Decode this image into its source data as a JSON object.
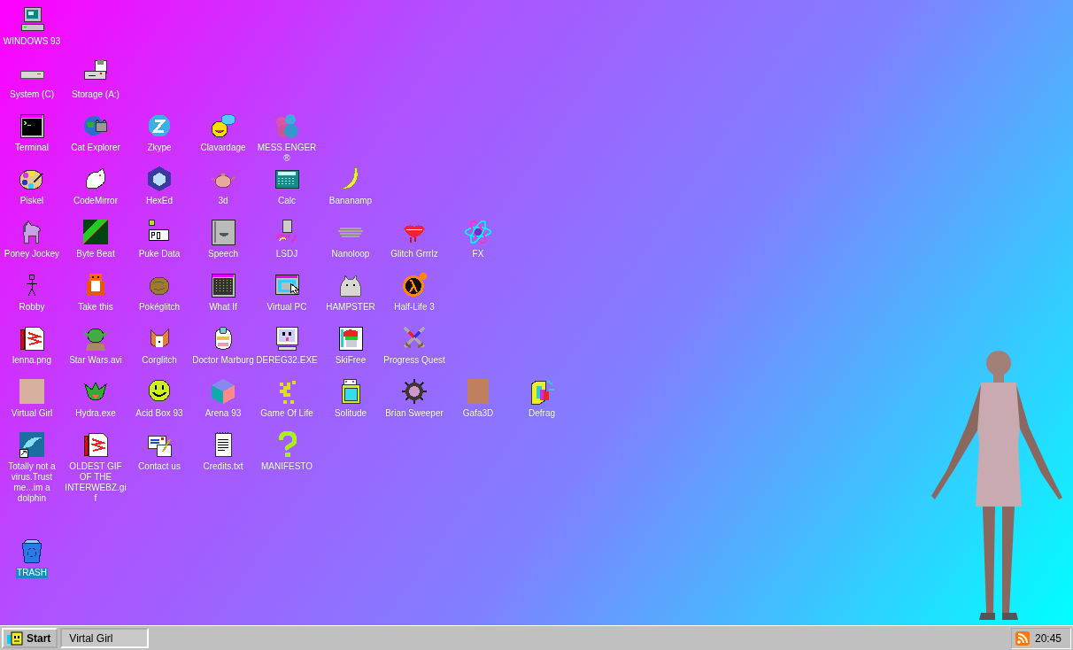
{
  "desktop": {
    "icon_rows": [
      [
        {
          "label": "WINDOWS 93",
          "selected": false
        }
      ],
      [
        {
          "label": "System (C)",
          "selected": false
        },
        {
          "label": "Storage (A:)",
          "selected": false
        }
      ],
      [
        {
          "label": "Terminal",
          "selected": false
        },
        {
          "label": "Cat Explorer",
          "selected": false
        },
        {
          "label": "Zkype",
          "selected": false
        },
        {
          "label": "Clavardage",
          "selected": false
        },
        {
          "label": "MESS.ENGER ®",
          "selected": false
        }
      ],
      [
        {
          "label": "Piskel",
          "selected": false
        },
        {
          "label": "CodeMirror",
          "selected": false
        },
        {
          "label": "HexEd",
          "selected": false
        },
        {
          "label": "3d",
          "selected": false
        },
        {
          "label": "Calc",
          "selected": false
        },
        {
          "label": "Bananamp",
          "selected": false
        }
      ],
      [
        {
          "label": "Poney Jockey",
          "selected": false
        },
        {
          "label": "Byte Beat",
          "selected": false
        },
        {
          "label": "Puke Data",
          "selected": false
        },
        {
          "label": "Speech",
          "selected": false
        },
        {
          "label": "LSDJ",
          "selected": false
        },
        {
          "label": "Nanoloop",
          "selected": false
        },
        {
          "label": "Glitch Grrrlz",
          "selected": false
        },
        {
          "label": "FX",
          "selected": false
        }
      ],
      [
        {
          "label": "Robby",
          "selected": false
        },
        {
          "label": "Take this",
          "selected": false
        },
        {
          "label": "Pokéglitch",
          "selected": false
        },
        {
          "label": "What If",
          "selected": false
        },
        {
          "label": "Virtual PC",
          "selected": false
        },
        {
          "label": "HAMPSTER",
          "selected": false
        },
        {
          "label": "Half-Life 3",
          "selected": false
        }
      ],
      [
        {
          "label": "lenna.png",
          "selected": false
        },
        {
          "label": "Star Wars.avi",
          "selected": false
        },
        {
          "label": "Corglitch",
          "selected": false
        },
        {
          "label": "Doctor Marburg",
          "selected": false
        },
        {
          "label": "DEREG32.EXE",
          "selected": false
        },
        {
          "label": "SkiFree",
          "selected": false
        },
        {
          "label": "Progress Quest",
          "selected": false
        }
      ],
      [
        {
          "label": "Virtual Girl",
          "selected": false
        },
        {
          "label": "Hydra.exe",
          "selected": false
        },
        {
          "label": "Acid Box 93",
          "selected": false
        },
        {
          "label": "Arena 93",
          "selected": false
        },
        {
          "label": "Game Of Life",
          "selected": false
        },
        {
          "label": "Solitude",
          "selected": false
        },
        {
          "label": "Brian Sweeper",
          "selected": false
        },
        {
          "label": "Gafa3D",
          "selected": false
        },
        {
          "label": "Defrag",
          "selected": false
        }
      ],
      [
        {
          "label": "Totally not a virus.Trust me...im a dolphin",
          "selected": false
        },
        {
          "label": "OLDEST GIF OF THE INTERWEBZ.gif",
          "selected": false
        },
        {
          "label": "Contact us",
          "selected": false
        },
        {
          "label": "Credits.txt",
          "selected": false
        },
        {
          "label": "MANIFESTO",
          "selected": false
        }
      ]
    ],
    "trash": {
      "label": "TRASH",
      "selected": true
    }
  },
  "taskbar": {
    "start_button": {
      "label": "Start"
    },
    "tasks": [
      {
        "label": "Virtal Girl",
        "selected": true
      }
    ],
    "tray": {
      "time": "20:45"
    }
  }
}
